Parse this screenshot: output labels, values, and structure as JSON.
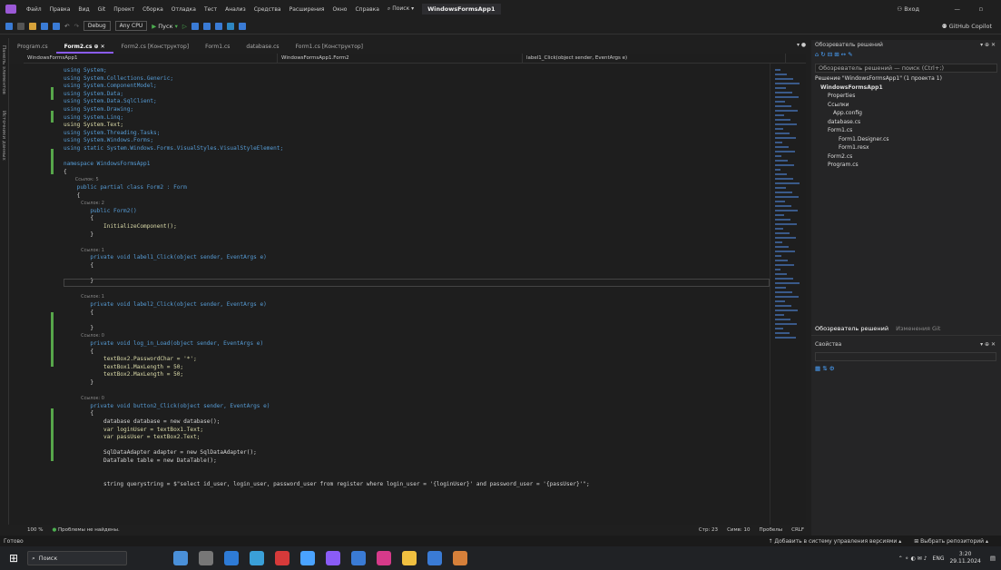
{
  "menu": {
    "items": [
      "Файл",
      "Правка",
      "Вид",
      "Git",
      "Проект",
      "Сборка",
      "Отладка",
      "Тест",
      "Анализ",
      "Средства",
      "Расширения",
      "Окно",
      "Справка"
    ],
    "search": "Поиск",
    "project": "WindowsFormsApp1",
    "signin": "Вход",
    "copilot": "GitHub Copilot"
  },
  "toolbar": {
    "config": "Debug",
    "platform": "Any CPU",
    "run": "Пуск"
  },
  "tabs": [
    {
      "label": "Program.cs",
      "active": false
    },
    {
      "label": "Form2.cs",
      "active": true
    },
    {
      "label": "Form2.cs [Конструктор]",
      "active": false
    },
    {
      "label": "Form1.cs",
      "active": false
    },
    {
      "label": "database.cs",
      "active": false
    },
    {
      "label": "Form1.cs [Конструктор]",
      "active": false
    }
  ],
  "navbar": {
    "project": "WindowsFormsApp1",
    "class": "WindowsFormsApp1.Form2",
    "member": "label1_Click(object sender, EventArgs e)"
  },
  "side_strip": {
    "toolbox": "Панель элементов",
    "datasources": "Источники данных"
  },
  "code_lines": [
    "using System;",
    "using System.Collections.Generic;",
    "using System.ComponentModel;",
    "using System.Data;",
    "using System.Data.SqlClient;",
    "using System.Drawing;",
    "using System.Linq;",
    "using System.Text;",
    "using System.Threading.Tasks;",
    "using System.Windows.Forms;",
    "using static System.Windows.Forms.VisualStyles.VisualStyleElement;",
    "",
    "namespace WindowsFormsApp1",
    "{",
    "        Ссылок: 5",
    "    public partial class Form2 : Form",
    "    {",
    "            Ссылок: 2",
    "        public Form2()",
    "        {",
    "            InitializeComponent();",
    "        }",
    "",
    "            Ссылок: 1",
    "        private void label1_Click(object sender, EventArgs e)",
    "        {",
    "",
    "        }",
    "",
    "            Ссылок: 1",
    "        private void label2_Click(object sender, EventArgs e)",
    "        {",
    "",
    "        }",
    "            Ссылок: 0",
    "        private void log_in_Load(object sender, EventArgs e)",
    "        {",
    "            textBox2.PasswordChar = '*';",
    "            textBox1.MaxLength = 50;",
    "            textBox2.MaxLength = 50;",
    "        }",
    "",
    "            Ссылок: 0",
    "        private void button2_Click(object sender, EventArgs e)",
    "        {",
    "            database database = new database();",
    "            var loginUser = textBox1.Text;",
    "            var passUser = textBox2.Text;",
    "",
    "            SqlDataAdapter adapter = new SqlDataAdapter();",
    "            DataTable table = new DataTable();",
    "",
    "",
    "            string querystring = $\"select id_user, login_user, password_user from register where login_user = '{loginUser}' and password_user = '{passUser}'\";"
  ],
  "solution": {
    "title": "Обозреватель решений",
    "search": "Обозреватель решений — поиск (Ctrl+;)",
    "items": [
      "Решение \"WindowsFormsApp1\" (1 проекта 1)",
      "WindowsFormsApp1",
      "Properties",
      "Ссылки",
      "App.config",
      "database.cs",
      "Form1.cs",
      "Form1.Designer.cs",
      "Form1.resx",
      "Form2.cs",
      "Program.cs"
    ],
    "tab1": "Обозреватель решений",
    "tab2": "Изменения Git",
    "props": "Свойства"
  },
  "status": {
    "zoom": "100 %",
    "problems": "Проблемы не найдены.",
    "line": "Стр: 23",
    "col": "Симв: 10",
    "spaces": "Пробелы",
    "eol": "CRLF"
  },
  "bottom": {
    "ready": "Готово",
    "add": "Добавить в систему управления версиями",
    "repo": "Выбрать репозиторий"
  },
  "taskbar": {
    "search": "Поиск",
    "lang": "ENG",
    "time": "3:20",
    "date": "29.11.2024"
  }
}
